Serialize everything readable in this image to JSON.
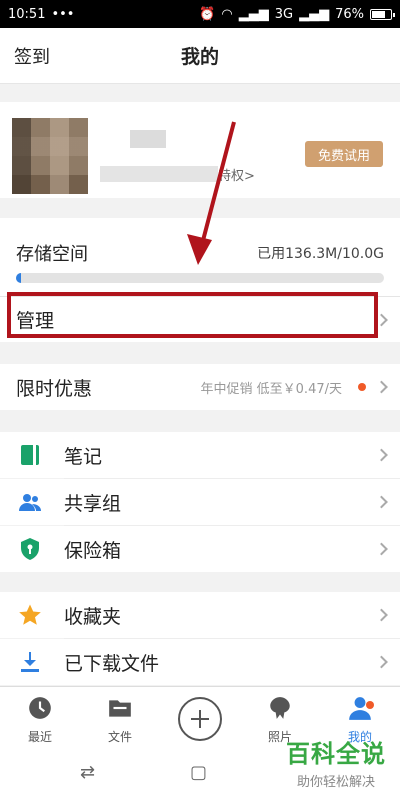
{
  "status_bar": {
    "time": "10:51",
    "network": "3G",
    "battery": "76%",
    "battery_level": 0.76
  },
  "header": {
    "checkin_label": "签到",
    "title": "我的"
  },
  "profile": {
    "privilege_text": "特权>",
    "trial_button": "免费试用"
  },
  "storage": {
    "label": "存储空间",
    "used_text": "已用136.3M/10.0G",
    "used_fraction": 0.0133
  },
  "manage": {
    "label": "管理"
  },
  "promo": {
    "label": "限时优惠",
    "subtitle": "年中促销 低至￥0.47/天"
  },
  "features": [
    {
      "label": "笔记",
      "icon": "note-icon"
    },
    {
      "label": "共享组",
      "icon": "group-icon"
    },
    {
      "label": "保险箱",
      "icon": "safe-icon"
    }
  ],
  "collections": [
    {
      "label": "收藏夹",
      "icon": "star-icon"
    },
    {
      "label": "已下载文件",
      "icon": "download-icon"
    }
  ],
  "tabs": [
    {
      "label": "最近",
      "icon": "clock-icon"
    },
    {
      "label": "文件",
      "icon": "folder-icon"
    },
    {
      "label": "",
      "icon": "plus-icon"
    },
    {
      "label": "照片",
      "icon": "photo-icon"
    },
    {
      "label": "我的",
      "icon": "person-icon"
    }
  ],
  "watermark": {
    "title": "百科全说",
    "subtitle": "助你轻松解决"
  },
  "colors": {
    "accent": "#2f7fe0",
    "highlight_border": "#b0141c",
    "trial_button": "#d0a070",
    "promo_dot": "#f05a28",
    "note_green": "#1aa26a",
    "star_orange": "#f5a623",
    "watermark_green": "#38a844"
  }
}
